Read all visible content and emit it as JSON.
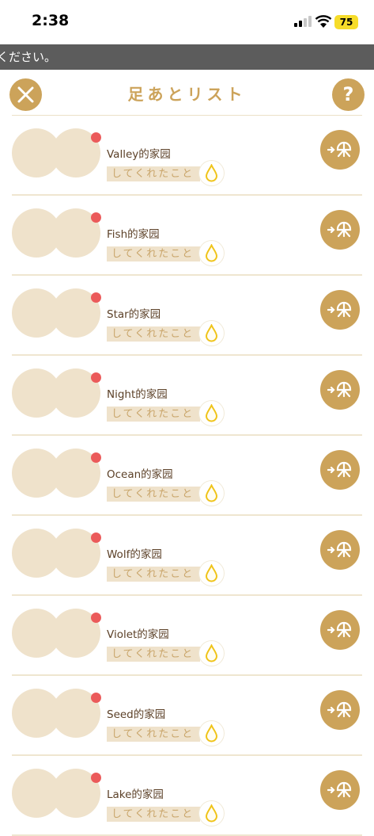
{
  "status_bar": {
    "time": "2:38",
    "battery": "75"
  },
  "banner": {
    "text": "ください。"
  },
  "header": {
    "title": "足あとリスト",
    "help_label": "?"
  },
  "rows": [
    {
      "name": "Valley的家园",
      "tag": "してくれたこと"
    },
    {
      "name": "Fish的家园",
      "tag": "してくれたこと"
    },
    {
      "name": "Star的家园",
      "tag": "してくれたこと"
    },
    {
      "name": "Night的家园",
      "tag": "してくれたこと"
    },
    {
      "name": "Ocean的家园",
      "tag": "してくれたこと"
    },
    {
      "name": "Wolf的家园",
      "tag": "してくれたこと"
    },
    {
      "name": "Violet的家园",
      "tag": "してくれたこと"
    },
    {
      "name": "Seed的家园",
      "tag": "してくれたこと"
    },
    {
      "name": "Lake的家园",
      "tag": "してくれたこと"
    }
  ],
  "colors": {
    "accent": "#cca35a",
    "avatar": "#efe2cb",
    "badge": "#eb5a5a",
    "text": "#5c4128"
  },
  "icons": {
    "close": "close-icon",
    "help": "help-icon",
    "drop": "water-drop-icon",
    "visit": "visit-garden-icon"
  }
}
